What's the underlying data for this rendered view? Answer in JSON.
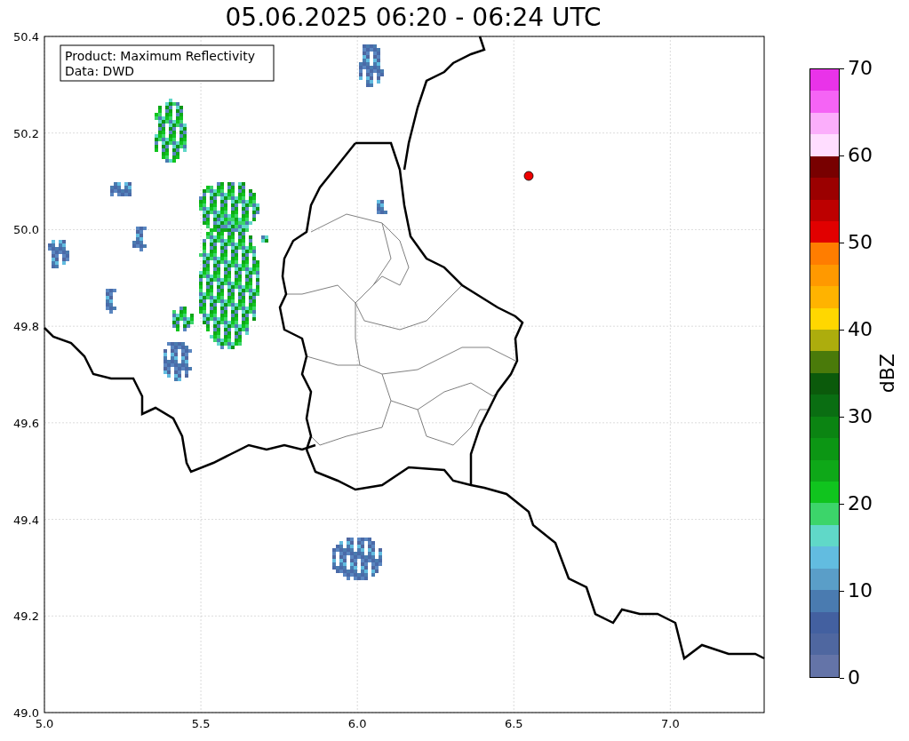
{
  "title": "05.06.2025 06:20 - 06:24 UTC",
  "info_box": [
    "Product: Maximum Reflectivity",
    "Data: DWD"
  ],
  "x_ticks": [
    "5.0",
    "5.5",
    "6.0",
    "6.5",
    "7.0"
  ],
  "y_ticks": [
    "50.4",
    "50.2",
    "50.0",
    "49.8",
    "49.6",
    "49.4",
    "49.2",
    "49.0"
  ],
  "colorbar": {
    "label": "dBZ",
    "ticks": [
      "70",
      "60",
      "50",
      "40",
      "30",
      "20",
      "10",
      "0"
    ],
    "bands": [
      {
        "color": "#e933e9"
      },
      {
        "color": "#f564f5"
      },
      {
        "color": "#fbaefb"
      },
      {
        "color": "#ffddff"
      },
      {
        "color": "#780000"
      },
      {
        "color": "#9b0000"
      },
      {
        "color": "#bd0000"
      },
      {
        "color": "#e10000"
      },
      {
        "color": "#ff7d00"
      },
      {
        "color": "#ff9900"
      },
      {
        "color": "#ffb300"
      },
      {
        "color": "#ffd700"
      },
      {
        "color": "#adad0d"
      },
      {
        "color": "#4a7a0a"
      },
      {
        "color": "#0b5a0b"
      },
      {
        "color": "#0a6e12"
      },
      {
        "color": "#0b8412"
      },
      {
        "color": "#0c9614"
      },
      {
        "color": "#0ea818"
      },
      {
        "color": "#10c41e"
      },
      {
        "color": "#3cd56a"
      },
      {
        "color": "#60d8c8"
      },
      {
        "color": "#62bce0"
      },
      {
        "color": "#5a9ec8"
      },
      {
        "color": "#4a7bb0"
      },
      {
        "color": "#4360a0"
      },
      {
        "color": "#4f67a0"
      },
      {
        "color": "#6474a8"
      }
    ]
  }
}
